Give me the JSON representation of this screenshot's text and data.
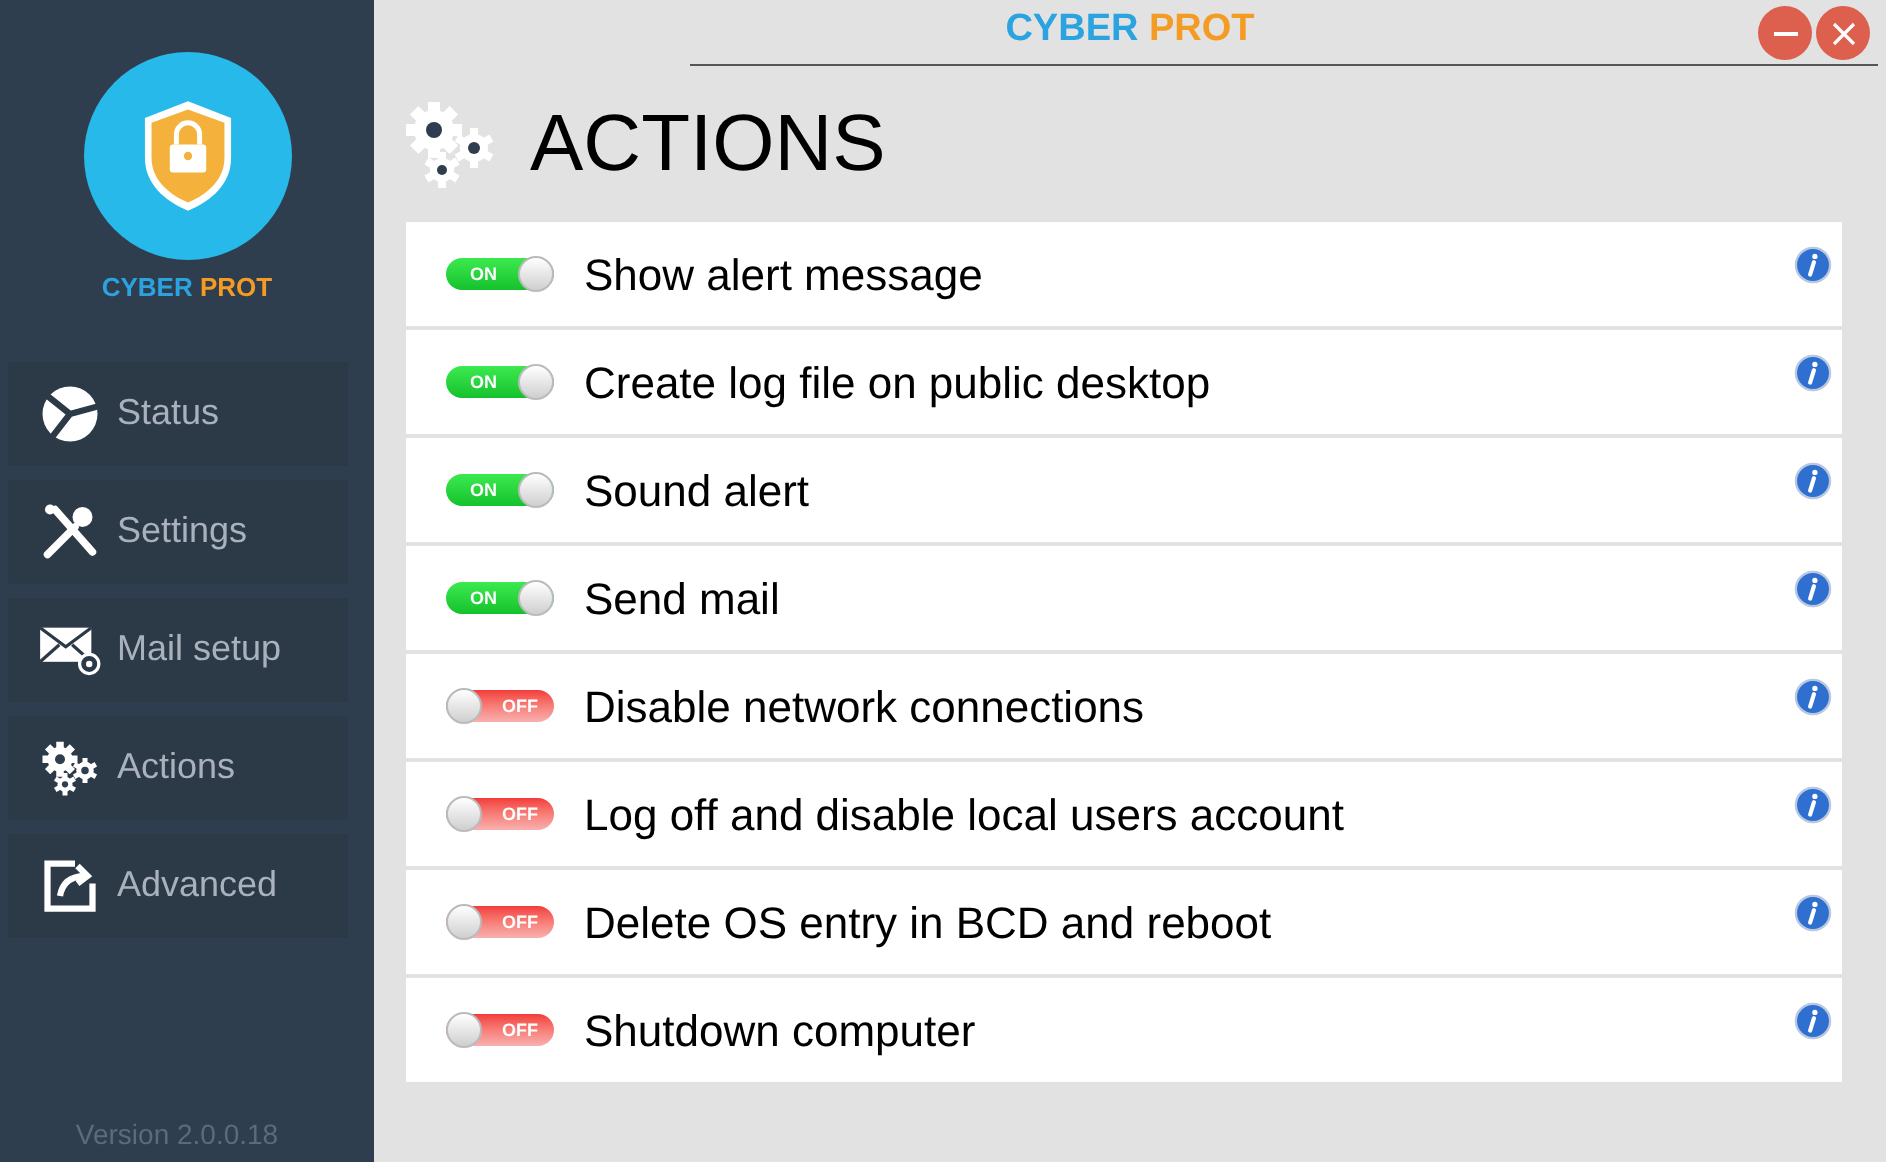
{
  "window": {
    "title_part_1": "CYBER",
    "title_part_2": "PROT"
  },
  "logo": {
    "text_part_1": "CYBER",
    "text_part_2": "PROT"
  },
  "sidebar": {
    "items": [
      {
        "label": "Status"
      },
      {
        "label": "Settings"
      },
      {
        "label": "Mail setup"
      },
      {
        "label": "Actions"
      },
      {
        "label": "Advanced"
      }
    ],
    "version": "Version 2.0.0.18"
  },
  "heading": "ACTIONS",
  "actions": [
    {
      "label": "Show alert message",
      "on": true,
      "switch_text": "ON"
    },
    {
      "label": "Create log file on public desktop",
      "on": true,
      "switch_text": "ON"
    },
    {
      "label": "Sound alert",
      "on": true,
      "switch_text": "ON"
    },
    {
      "label": "Send mail",
      "on": true,
      "switch_text": "ON"
    },
    {
      "label": "Disable network connections",
      "on": false,
      "switch_text": "OFF"
    },
    {
      "label": "Log off and disable local users account",
      "on": false,
      "switch_text": "OFF"
    },
    {
      "label": "Delete OS entry in BCD and reboot",
      "on": false,
      "switch_text": "OFF"
    },
    {
      "label": "Shutdown computer",
      "on": false,
      "switch_text": "OFF"
    }
  ]
}
